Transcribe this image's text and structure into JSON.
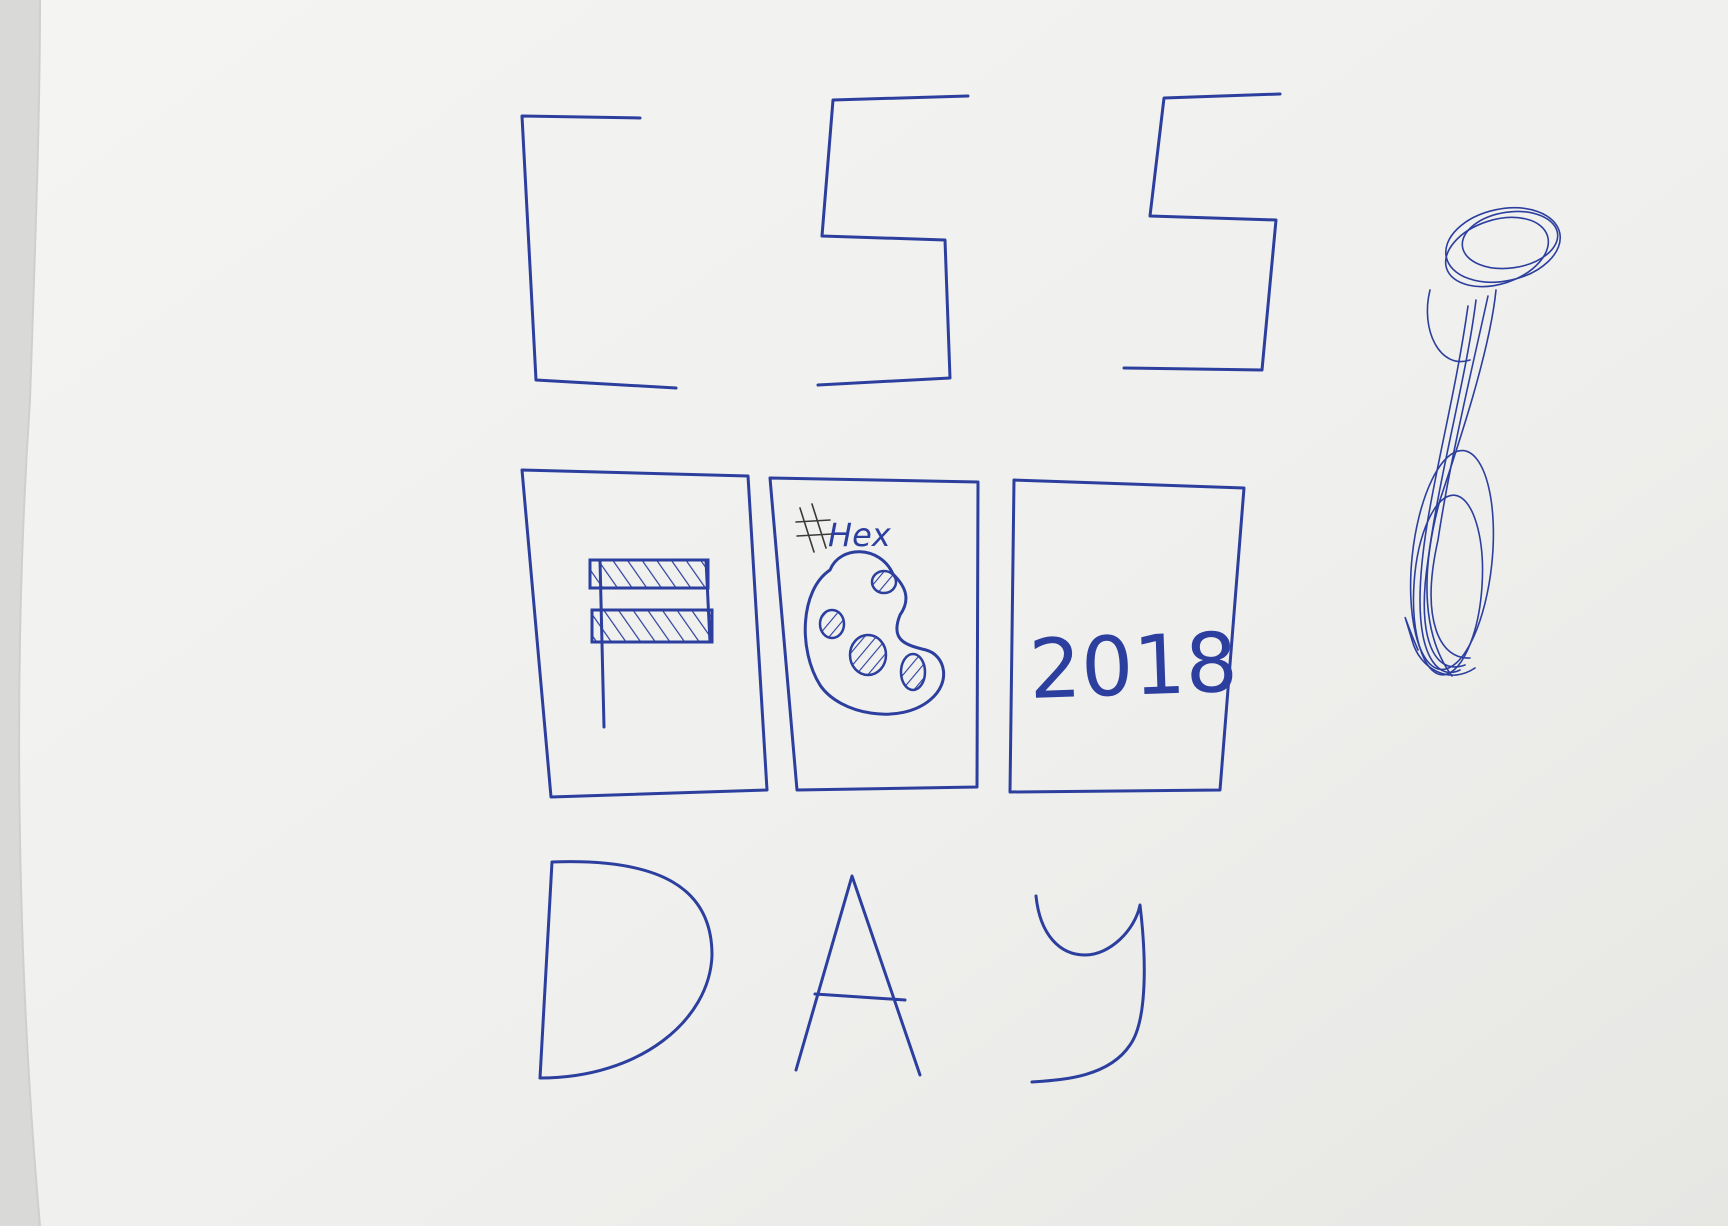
{
  "drawing": {
    "title_top": "CSS",
    "title_bottom": "DAY",
    "panel_year": "2018",
    "palette_note": "Hex",
    "ink_color": "#2c3f9e",
    "paper_color": "#f1f1ef"
  }
}
